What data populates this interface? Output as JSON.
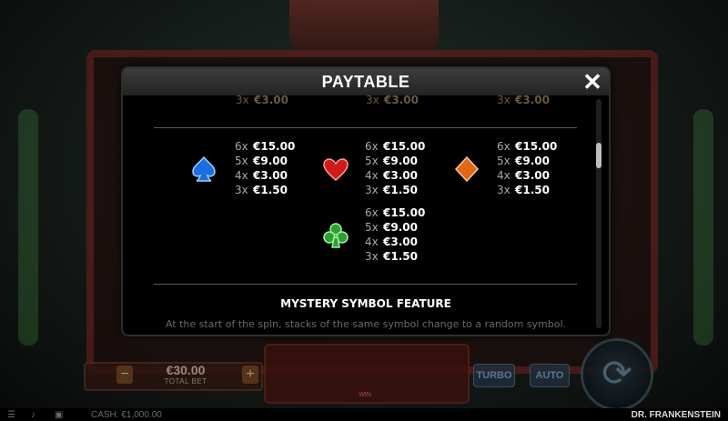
{
  "modal": {
    "title": "PAYTABLE",
    "close_label": "✕",
    "top_rows": [
      {
        "mult": "3x",
        "amount": "€3.00"
      },
      {
        "mult": "3x",
        "amount": "€3.00"
      },
      {
        "mult": "3x",
        "amount": "€3.00"
      }
    ],
    "symbols": [
      {
        "name": "blue-spade",
        "icon": "spade-icon",
        "color": "#1a6fe0",
        "rows": [
          {
            "mult": "6x",
            "amount": "€15.00"
          },
          {
            "mult": "5x",
            "amount": "€9.00"
          },
          {
            "mult": "4x",
            "amount": "€3.00"
          },
          {
            "mult": "3x",
            "amount": "€1.50"
          }
        ]
      },
      {
        "name": "red-heart",
        "icon": "heart-icon",
        "color": "#d11a1a",
        "rows": [
          {
            "mult": "6x",
            "amount": "€15.00"
          },
          {
            "mult": "5x",
            "amount": "€9.00"
          },
          {
            "mult": "4x",
            "amount": "€3.00"
          },
          {
            "mult": "3x",
            "amount": "€1.50"
          }
        ]
      },
      {
        "name": "orange-diamond",
        "icon": "diamond-icon",
        "color": "#e0661a",
        "rows": [
          {
            "mult": "6x",
            "amount": "€15.00"
          },
          {
            "mult": "5x",
            "amount": "€9.00"
          },
          {
            "mult": "4x",
            "amount": "€3.00"
          },
          {
            "mult": "3x",
            "amount": "€1.50"
          }
        ]
      },
      {
        "name": "green-club",
        "icon": "club-icon",
        "color": "#2fa02f",
        "rows": [
          {
            "mult": "6x",
            "amount": "€15.00"
          },
          {
            "mult": "5x",
            "amount": "€9.00"
          },
          {
            "mult": "4x",
            "amount": "€3.00"
          },
          {
            "mult": "3x",
            "amount": "€1.50"
          }
        ]
      }
    ],
    "feature_title": "MYSTERY SYMBOL FEATURE",
    "feature_desc": "At the start of the spin, stacks of the same symbol change to a random symbol."
  },
  "bottom": {
    "bet_value": "€30.00",
    "bet_caption": "TOTAL BET",
    "bet_minus": "−",
    "bet_plus": "+",
    "win_label": "WIN",
    "turbo_label": "TURBO",
    "auto_label": "AUTO",
    "spin_icon": "⟳",
    "cash_label": "CASH: €1,000.00",
    "game_title": "DR. FRANKENSTEIN"
  },
  "colors": {
    "accent": "#ffffff",
    "frame": "#5a1d1a",
    "header": "#333333"
  }
}
